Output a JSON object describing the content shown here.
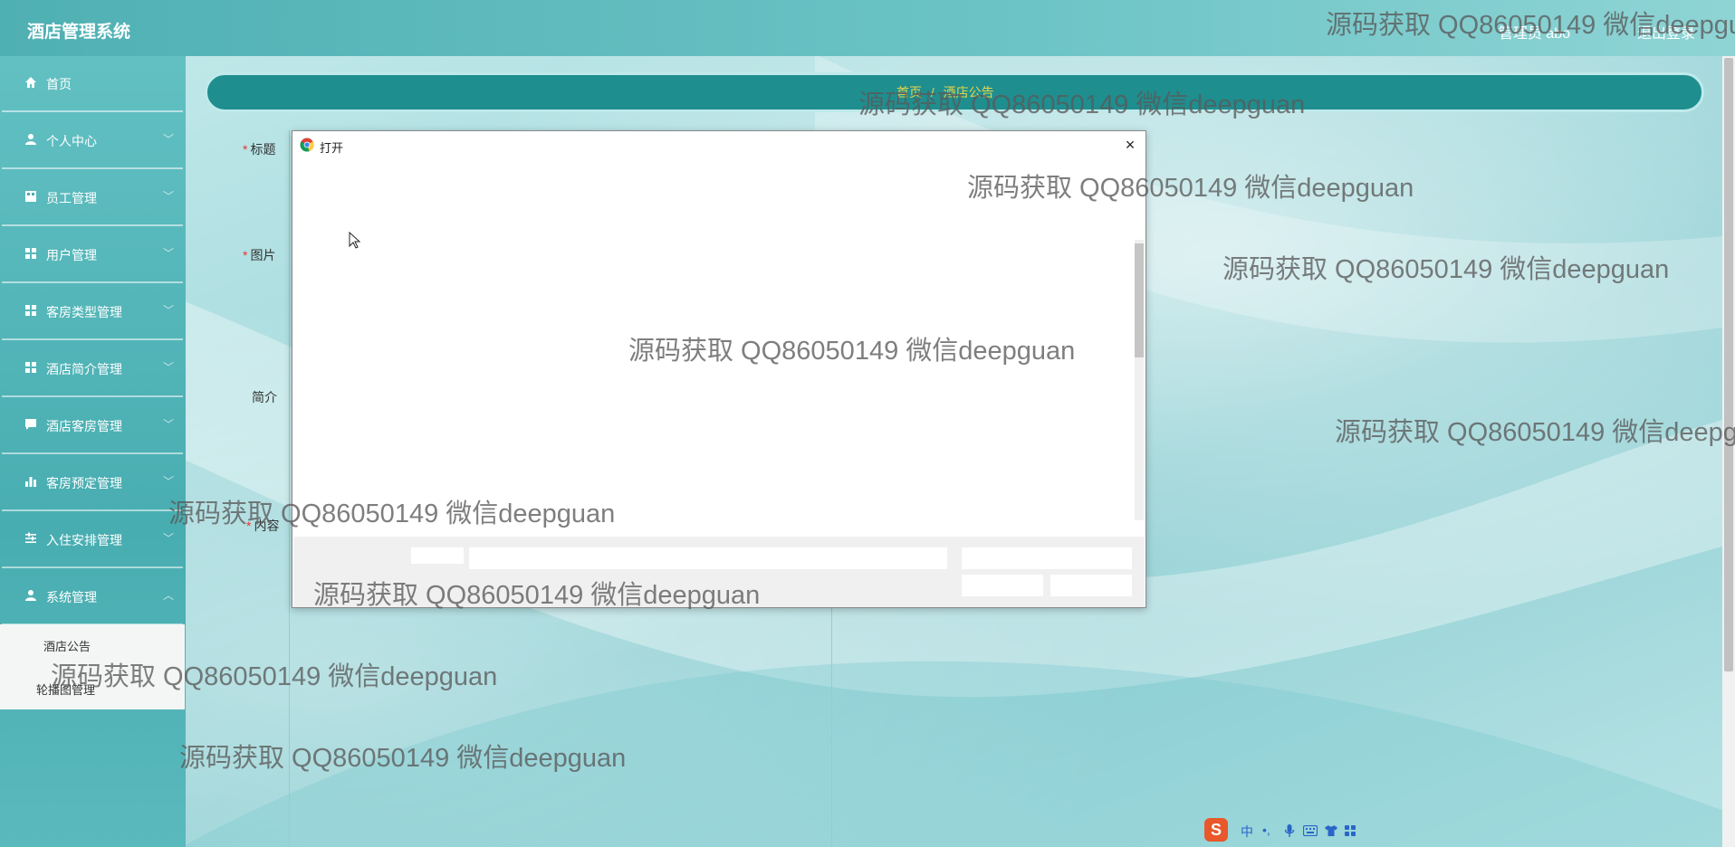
{
  "header": {
    "app_title": "酒店管理系统",
    "user": "管理员 abo",
    "logout": "退出登录"
  },
  "sidebar": {
    "items": [
      {
        "label": "首页",
        "icon": "home-icon"
      },
      {
        "label": "个人中心",
        "icon": "person-icon"
      },
      {
        "label": "员工管理",
        "icon": "building-icon"
      },
      {
        "label": "用户管理",
        "icon": "grid-icon"
      },
      {
        "label": "客房类型管理",
        "icon": "grid-icon"
      },
      {
        "label": "酒店简介管理",
        "icon": "grid-icon"
      },
      {
        "label": "酒店客房管理",
        "icon": "chat-icon"
      },
      {
        "label": "客房预定管理",
        "icon": "bar-chart-icon"
      },
      {
        "label": "入住安排管理",
        "icon": "sliders-icon"
      },
      {
        "label": "系统管理",
        "icon": "person-icon"
      }
    ],
    "submenu": [
      "酒店公告",
      "轮播图管理"
    ]
  },
  "breadcrumb": {
    "home": "首页",
    "sep": "/",
    "current": "酒店公告"
  },
  "form": {
    "title_label": "标题",
    "image_label": "图片",
    "intro_label": "简介",
    "content_label": "内容"
  },
  "dialog": {
    "title": "打开",
    "close": "×"
  },
  "watermark": "源码获取 QQ86050149 微信deepguan",
  "ime": {
    "logo": "S",
    "lang": "中",
    "punct": "•,"
  },
  "colors": {
    "header": "#4fb0b3",
    "sidebar": "#48adb1",
    "breadcrumb_bar": "#1f8e8f",
    "breadcrumb_text": "#e4d64a"
  }
}
